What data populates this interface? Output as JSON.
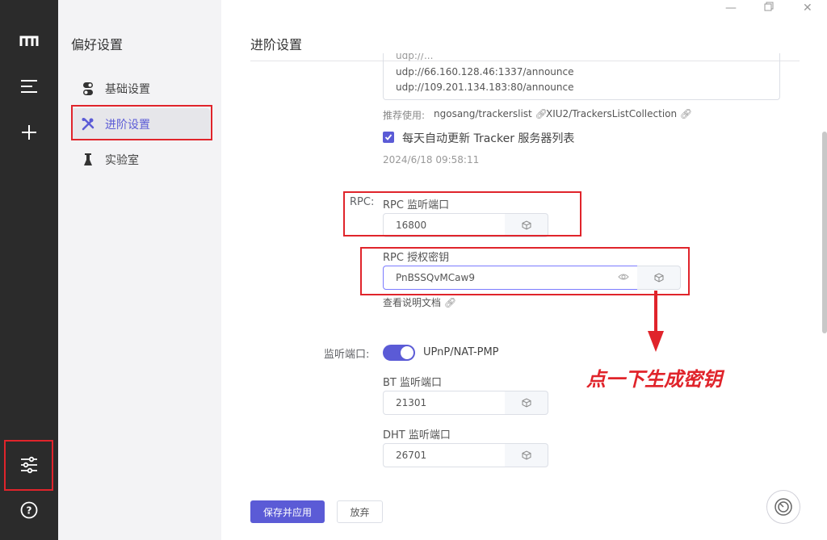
{
  "rail": {
    "logo_icon": "motrix-logo-icon",
    "items": [
      "menu-icon",
      "add-icon"
    ],
    "bottom": [
      "preferences-icon",
      "help-icon"
    ]
  },
  "sidebar": {
    "title": "偏好设置",
    "items": [
      {
        "label": "基础设置",
        "icon": "toggle-icon"
      },
      {
        "label": "进阶设置",
        "icon": "tools-icon"
      },
      {
        "label": "实验室",
        "icon": "flask-icon"
      }
    ]
  },
  "main": {
    "title": "进阶设置",
    "window_controls": [
      "minimize-icon",
      "restore-icon",
      "close-icon"
    ],
    "tracker": {
      "lines": [
        "udp://66.160.128.46:1337/announce",
        "udp://109.201.134.183:80/announce"
      ],
      "recommend_label": "推荐使用:",
      "source1": "ngosang/trackerslist",
      "source2": "XIU2/TrackersListCollection",
      "auto_update_label": "每天自动更新 Tracker 服务器列表",
      "auto_update_checked": true,
      "last_updated": "2024/6/18 09:58:11"
    },
    "rpc": {
      "section_label": "RPC:",
      "port_label": "RPC 监听端口",
      "port_value": "16800",
      "secret_label": "RPC 授权密钥",
      "secret_value": "PnBSSQvMCaw9",
      "docs_link": "查看说明文档"
    },
    "ports": {
      "section_label": "监听端口:",
      "upnp_label": "UPnP/NAT-PMP",
      "upnp_enabled": true,
      "bt_label": "BT 监听端口",
      "bt_value": "21301",
      "dht_label": "DHT 监听端口",
      "dht_value": "26701"
    },
    "buttons": {
      "save": "保存并应用",
      "discard": "放弃"
    },
    "annotation": "点一下生成密钥"
  },
  "colors": {
    "accent": "#5b5bd6",
    "rail_bg": "#2b2b2b",
    "annotation_red": "#e0242b"
  }
}
